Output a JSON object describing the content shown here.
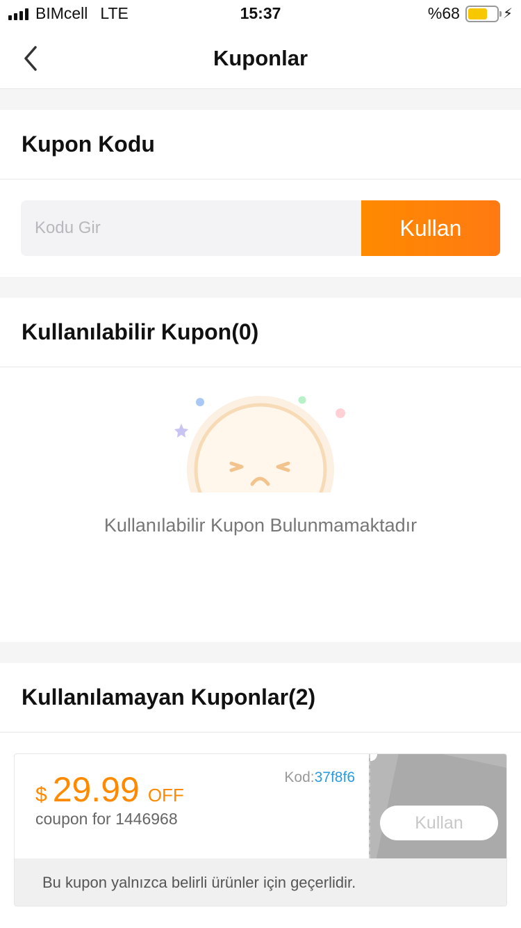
{
  "status_bar": {
    "carrier": "BIMcell",
    "network": "LTE",
    "time": "15:37",
    "battery": "%68",
    "battery_level": 0.68
  },
  "nav": {
    "title": "Kuponlar",
    "back_icon": "chevron-left-icon"
  },
  "coupon_code": {
    "header": "Kupon Kodu",
    "placeholder": "Kodu Gir",
    "value": "",
    "button_label": "Kullan"
  },
  "available": {
    "header": "Kullanılabilir Kupon(0)",
    "empty_message": "Kullanılabilir Kupon Bulunmamaktadır"
  },
  "unavailable": {
    "header": "Kullanılamayan Kuponlar(2)",
    "coupons": [
      {
        "currency": "$",
        "amount": "29.99",
        "off_label": "OFF",
        "description": "coupon for 1446968",
        "code_label": "Kod:",
        "code_value": "37f8f6",
        "button_label": "Kullan",
        "note": "Bu kupon yalnızca belirli ürünler için geçerlidir."
      }
    ]
  },
  "colors": {
    "accent": "#ff8a00",
    "code_link": "#2a9be0",
    "disabled_panel": "#b7b7b7"
  }
}
